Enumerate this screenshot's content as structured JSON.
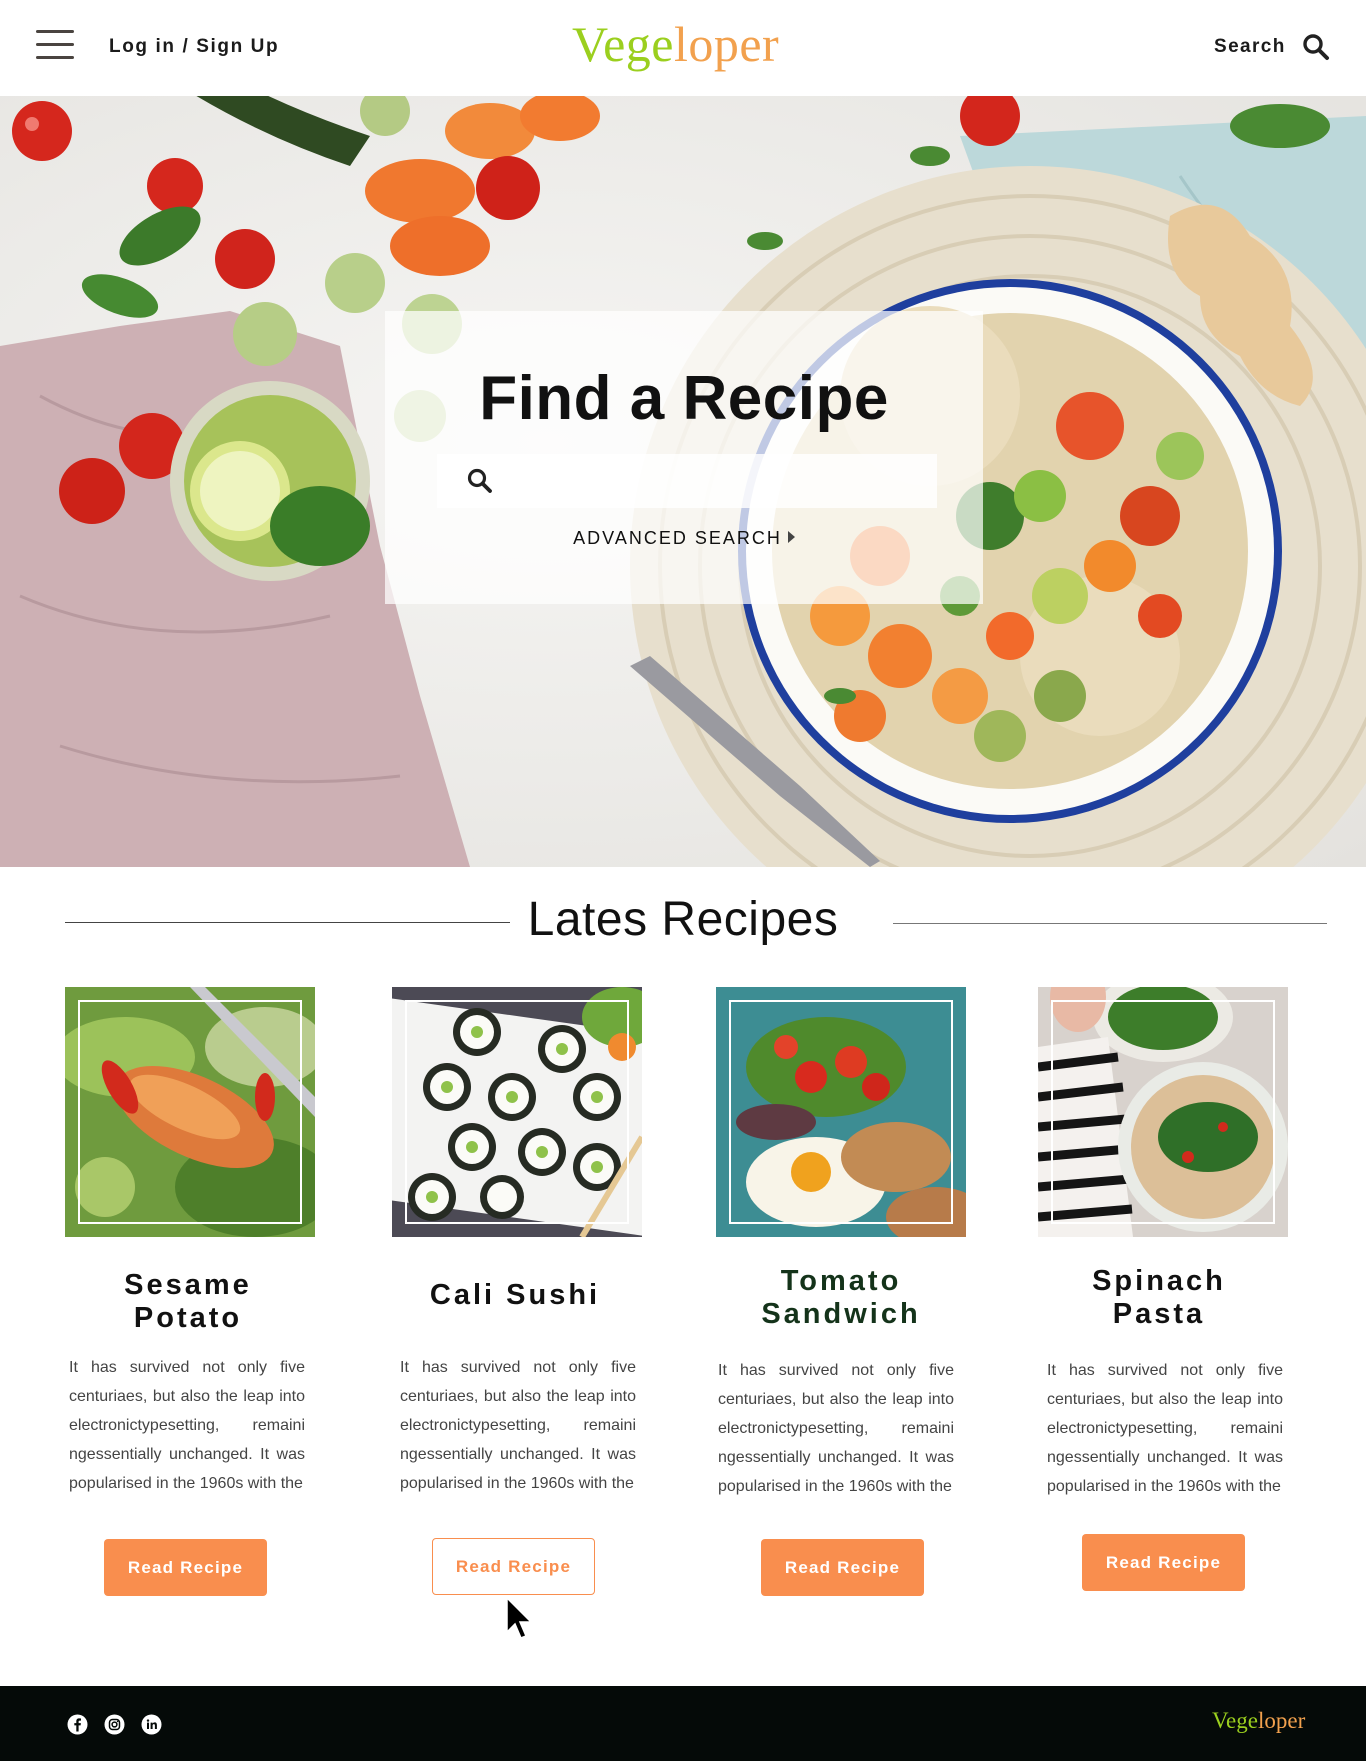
{
  "header": {
    "login_label": "Log in / Sign Up",
    "logo_part1": "Vege",
    "logo_part2": "loper",
    "search_label": "Search"
  },
  "hero": {
    "title": "Find a Recipe",
    "search_placeholder": "",
    "advanced_search_label": "ADVANCED SEARCH"
  },
  "latest": {
    "title": "Lates Recipes",
    "recipes": [
      {
        "title": "Sesame\nPotato",
        "description": "It has survived not only five centuriaes, but also the leap into electronictypesetting, remaini ngessentially unchanged. It was popularised in the 1960s with the",
        "button_label": "Read Recipe"
      },
      {
        "title": "Cali Sushi",
        "description": "It has survived not only five centuriaes, but also the leap into electronictypesetting, remaini ngessentially unchanged. It was popularised in the 1960s with the",
        "button_label": "Read Recipe"
      },
      {
        "title": "Tomato\nSandwich",
        "description": "It has survived not only five centuriaes, but also the leap into electronictypesetting, remaini ngessentially unchanged. It was popularised in the 1960s with the",
        "button_label": "Read Recipe"
      },
      {
        "title": "Spinach\nPasta",
        "description": "It has survived not only five centuriaes, but also the leap into electronictypesetting, remaini ngessentially unchanged. It was popularised in the 1960s with the",
        "button_label": "Read Recipe"
      }
    ]
  },
  "footer": {
    "logo_part1": "Vege",
    "logo_part2": "loper",
    "social_icons": [
      "facebook-icon",
      "instagram-icon",
      "linkedin-icon"
    ]
  },
  "colors": {
    "accent_orange": "#f98e4e",
    "logo_green": "#9bcf1e",
    "logo_orange": "#f2a14e",
    "footer_bg": "#050a08"
  }
}
